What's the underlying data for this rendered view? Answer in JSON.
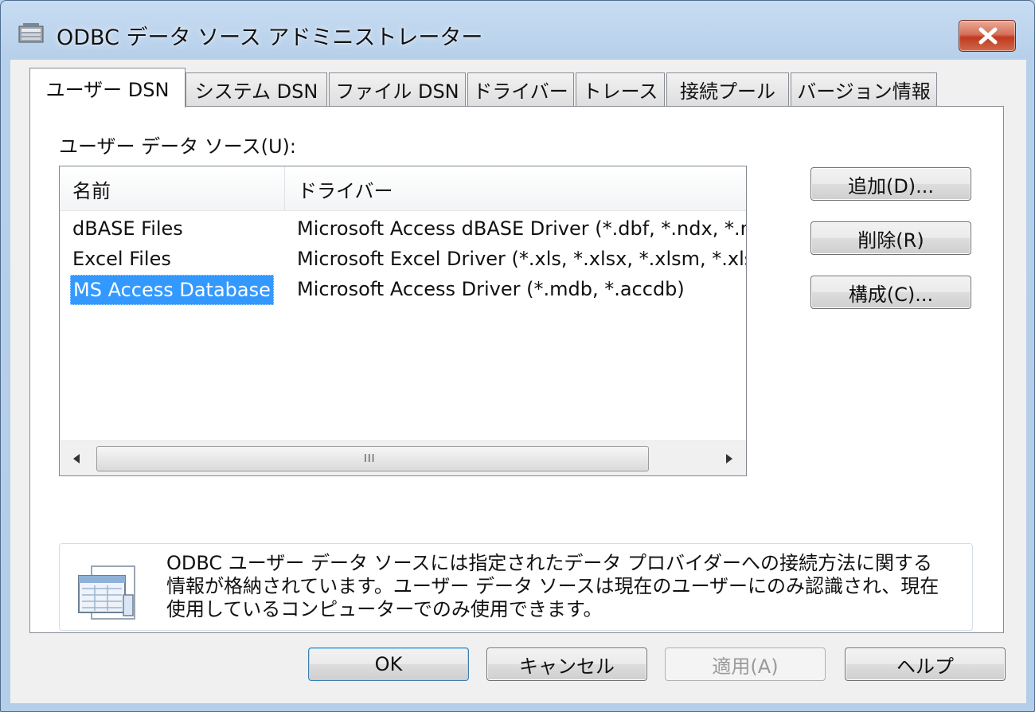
{
  "window": {
    "title": "ODBC データ ソース アドミニストレーター",
    "close_label": "×"
  },
  "tabs": [
    {
      "label": "ユーザー DSN",
      "active": true
    },
    {
      "label": "システム DSN"
    },
    {
      "label": "ファイル DSN"
    },
    {
      "label": "ドライバー"
    },
    {
      "label": "トレース"
    },
    {
      "label": "接続プール"
    },
    {
      "label": "バージョン情報"
    }
  ],
  "panel": {
    "section_label": "ユーザー データ ソース(U):",
    "columns": [
      "名前",
      "ドライバー"
    ],
    "rows": [
      {
        "name": "dBASE Files",
        "driver": "Microsoft Access dBASE Driver (*.dbf, *.ndx, *.mdx)"
      },
      {
        "name": "Excel Files",
        "driver": "Microsoft Excel Driver (*.xls, *.xlsx, *.xlsm, *.xlsb)"
      },
      {
        "name": "MS Access Database",
        "driver": "Microsoft Access Driver (*.mdb, *.accdb)",
        "selected": true
      }
    ],
    "scrollbar_grip": "III",
    "buttons": {
      "add": "追加(D)...",
      "remove": "削除(R)",
      "configure": "構成(C)..."
    },
    "info": {
      "line1": "ODBC ユーザー データ ソースには指定されたデータ プロバイダーへの接続方法に関する",
      "line2": "情報が格納されています。ユーザー データ ソースは現在のユーザーにのみ認識され、現在",
      "line3": "使用しているコンピューターでのみ使用できます。"
    }
  },
  "footer": {
    "ok": "OK",
    "cancel": "キャンセル",
    "apply": "適用(A)",
    "help": "ヘルプ"
  },
  "colors": {
    "selection": "#3399ff",
    "close_button": "#c0391f",
    "title_bar": "#b9d1ea"
  }
}
